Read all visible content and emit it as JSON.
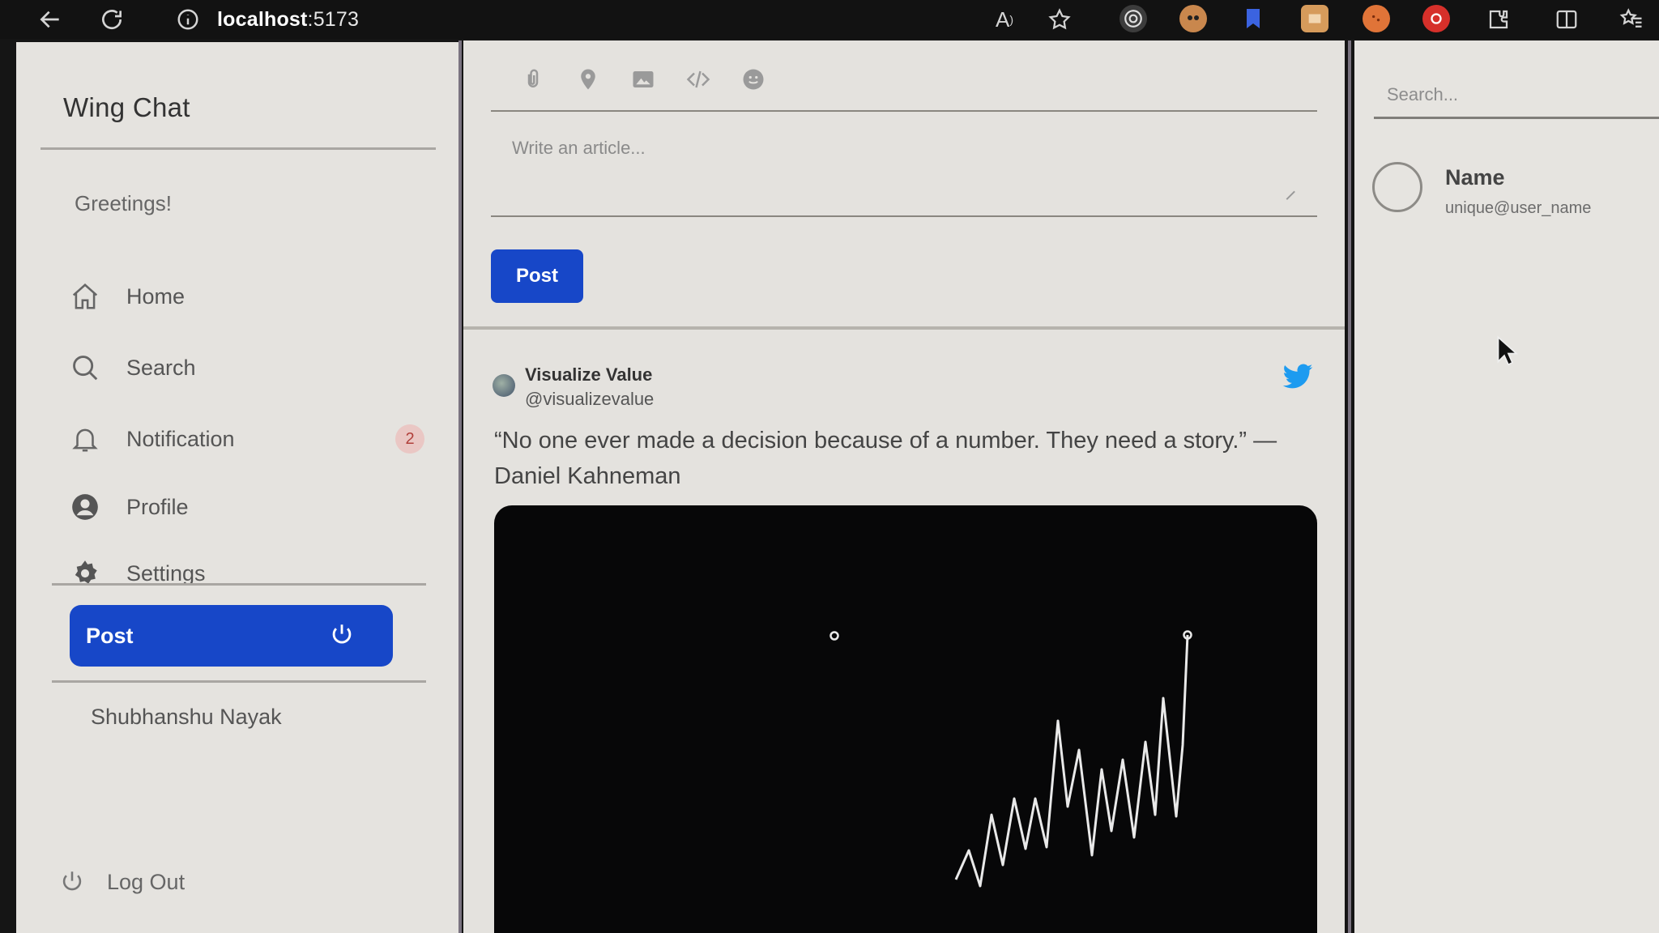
{
  "browser": {
    "url_host": "localhost",
    "url_port": ":5173"
  },
  "sidebar": {
    "brand": "Wing Chat",
    "greeting": "Greetings!",
    "items": [
      {
        "label": "Home",
        "icon": "home-icon"
      },
      {
        "label": "Search",
        "icon": "search-icon"
      },
      {
        "label": "Notification",
        "icon": "bell-icon",
        "badge": "2"
      },
      {
        "label": "Profile",
        "icon": "user-icon"
      },
      {
        "label": "Settings",
        "icon": "gear-icon"
      }
    ],
    "post_label": "Post",
    "user_name": "Shubhanshu Nayak",
    "logout_label": "Log Out"
  },
  "composer": {
    "toolbar_icons": [
      "attachment-icon",
      "location-icon",
      "image-icon",
      "code-icon",
      "emoji-icon"
    ],
    "placeholder": "Write an article...",
    "post_label": "Post"
  },
  "tweet": {
    "author_name": "Visualize Value",
    "author_handle": "@visualizevalue",
    "text": "“No one ever made a decision because of a number. They need a story.” — Daniel Kahneman",
    "icon": "twitter-bird-icon"
  },
  "rightbar": {
    "search_placeholder": "Search...",
    "profile_name": "Name",
    "profile_handle": "unique@user_name"
  },
  "colors": {
    "accent": "#1747c8",
    "badge_bg": "#eac7c4",
    "badge_text": "#b1403b",
    "twitter": "#1d9bf0",
    "panel_bg": "#e5e3df"
  }
}
